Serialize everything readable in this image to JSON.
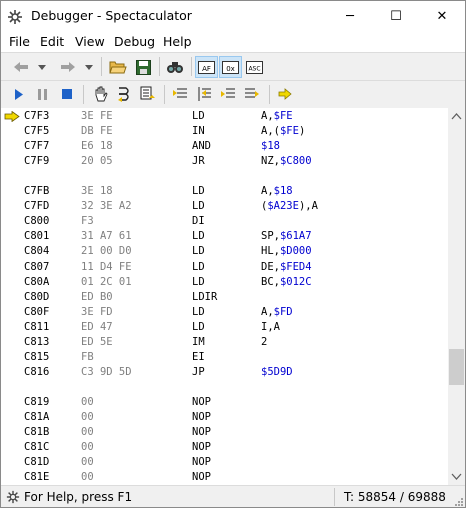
{
  "window": {
    "title": "Debugger - Spectaculator"
  },
  "title_controls": {
    "minimize": "─",
    "maximize": "☐",
    "close": "✕"
  },
  "menu": [
    "File",
    "Edit",
    "View",
    "Debug",
    "Help"
  ],
  "toolbar1": {
    "icons": [
      "back-arrow-icon",
      "back-dropdown-icon",
      "forward-arrow-icon",
      "forward-dropdown-icon",
      "open-folder-icon",
      "save-icon",
      "find-icon",
      "registers-af-icon",
      "hex-0x-icon",
      "ascii-asc-icon"
    ],
    "pressed": {
      "af_label": "AF",
      "hex_label": "0x",
      "asc_label": "ASC"
    }
  },
  "toolbar2": {
    "icons": [
      "run-icon",
      "pause-icon",
      "stop-icon",
      "hand-icon",
      "step-into-icon",
      "step-over-icon",
      "step-out-icon",
      "run-to-cursor-icon",
      "toggle-breakpoint-icon",
      "clear-breakpoints-icon",
      "go-to-pc-icon"
    ]
  },
  "colors": {
    "accent_blue": "#0000d0",
    "bytes_grey": "#808080",
    "pc_marker": "#f0d800"
  },
  "listing": {
    "current_pc_row": 0,
    "rows": [
      {
        "addr": "C7F3",
        "bytes": "3E FE",
        "mnem": "LD",
        "op_pre": "A,",
        "op_lit": "$FE",
        "op_post": ""
      },
      {
        "addr": "C7F5",
        "bytes": "DB FE",
        "mnem": "IN",
        "op_pre": "A,(",
        "op_lit": "$FE",
        "op_post": ")"
      },
      {
        "addr": "C7F7",
        "bytes": "E6 18",
        "mnem": "AND",
        "op_pre": "",
        "op_lit": "$18",
        "op_post": ""
      },
      {
        "addr": "C7F9",
        "bytes": "20 05",
        "mnem": "JR",
        "op_pre": "NZ,",
        "op_lit": "$C800",
        "op_post": ""
      },
      {
        "addr": "",
        "bytes": "",
        "mnem": "",
        "op_pre": "",
        "op_lit": "",
        "op_post": ""
      },
      {
        "addr": "C7FB",
        "bytes": "3E 18",
        "mnem": "LD",
        "op_pre": "A,",
        "op_lit": "$18",
        "op_post": ""
      },
      {
        "addr": "C7FD",
        "bytes": "32 3E A2",
        "mnem": "LD",
        "op_pre": "(",
        "op_lit": "$A23E",
        "op_post": "),A"
      },
      {
        "addr": "C800",
        "bytes": "F3",
        "mnem": "DI",
        "op_pre": "",
        "op_lit": "",
        "op_post": ""
      },
      {
        "addr": "C801",
        "bytes": "31 A7 61",
        "mnem": "LD",
        "op_pre": "SP,",
        "op_lit": "$61A7",
        "op_post": ""
      },
      {
        "addr": "C804",
        "bytes": "21 00 D0",
        "mnem": "LD",
        "op_pre": "HL,",
        "op_lit": "$D000",
        "op_post": ""
      },
      {
        "addr": "C807",
        "bytes": "11 D4 FE",
        "mnem": "LD",
        "op_pre": "DE,",
        "op_lit": "$FED4",
        "op_post": ""
      },
      {
        "addr": "C80A",
        "bytes": "01 2C 01",
        "mnem": "LD",
        "op_pre": "BC,",
        "op_lit": "$012C",
        "op_post": ""
      },
      {
        "addr": "C80D",
        "bytes": "ED B0",
        "mnem": "LDIR",
        "op_pre": "",
        "op_lit": "",
        "op_post": ""
      },
      {
        "addr": "C80F",
        "bytes": "3E FD",
        "mnem": "LD",
        "op_pre": "A,",
        "op_lit": "$FD",
        "op_post": ""
      },
      {
        "addr": "C811",
        "bytes": "ED 47",
        "mnem": "LD",
        "op_pre": "I,A",
        "op_lit": "",
        "op_post": ""
      },
      {
        "addr": "C813",
        "bytes": "ED 5E",
        "mnem": "IM",
        "op_pre": "2",
        "op_lit": "",
        "op_post": ""
      },
      {
        "addr": "C815",
        "bytes": "FB",
        "mnem": "EI",
        "op_pre": "",
        "op_lit": "",
        "op_post": ""
      },
      {
        "addr": "C816",
        "bytes": "C3 9D 5D",
        "mnem": "JP",
        "op_pre": "",
        "op_lit": "$5D9D",
        "op_post": ""
      },
      {
        "addr": "",
        "bytes": "",
        "mnem": "",
        "op_pre": "",
        "op_lit": "",
        "op_post": ""
      },
      {
        "addr": "C819",
        "bytes": "00",
        "mnem": "NOP",
        "op_pre": "",
        "op_lit": "",
        "op_post": ""
      },
      {
        "addr": "C81A",
        "bytes": "00",
        "mnem": "NOP",
        "op_pre": "",
        "op_lit": "",
        "op_post": ""
      },
      {
        "addr": "C81B",
        "bytes": "00",
        "mnem": "NOP",
        "op_pre": "",
        "op_lit": "",
        "op_post": ""
      },
      {
        "addr": "C81C",
        "bytes": "00",
        "mnem": "NOP",
        "op_pre": "",
        "op_lit": "",
        "op_post": ""
      },
      {
        "addr": "C81D",
        "bytes": "00",
        "mnem": "NOP",
        "op_pre": "",
        "op_lit": "",
        "op_post": ""
      },
      {
        "addr": "C81E",
        "bytes": "00",
        "mnem": "NOP",
        "op_pre": "",
        "op_lit": "",
        "op_post": ""
      }
    ]
  },
  "scrollbar": {
    "position_fraction": 0.73
  },
  "status": {
    "help": "For Help, press F1",
    "tstates": "T: 58854 / 69888"
  }
}
